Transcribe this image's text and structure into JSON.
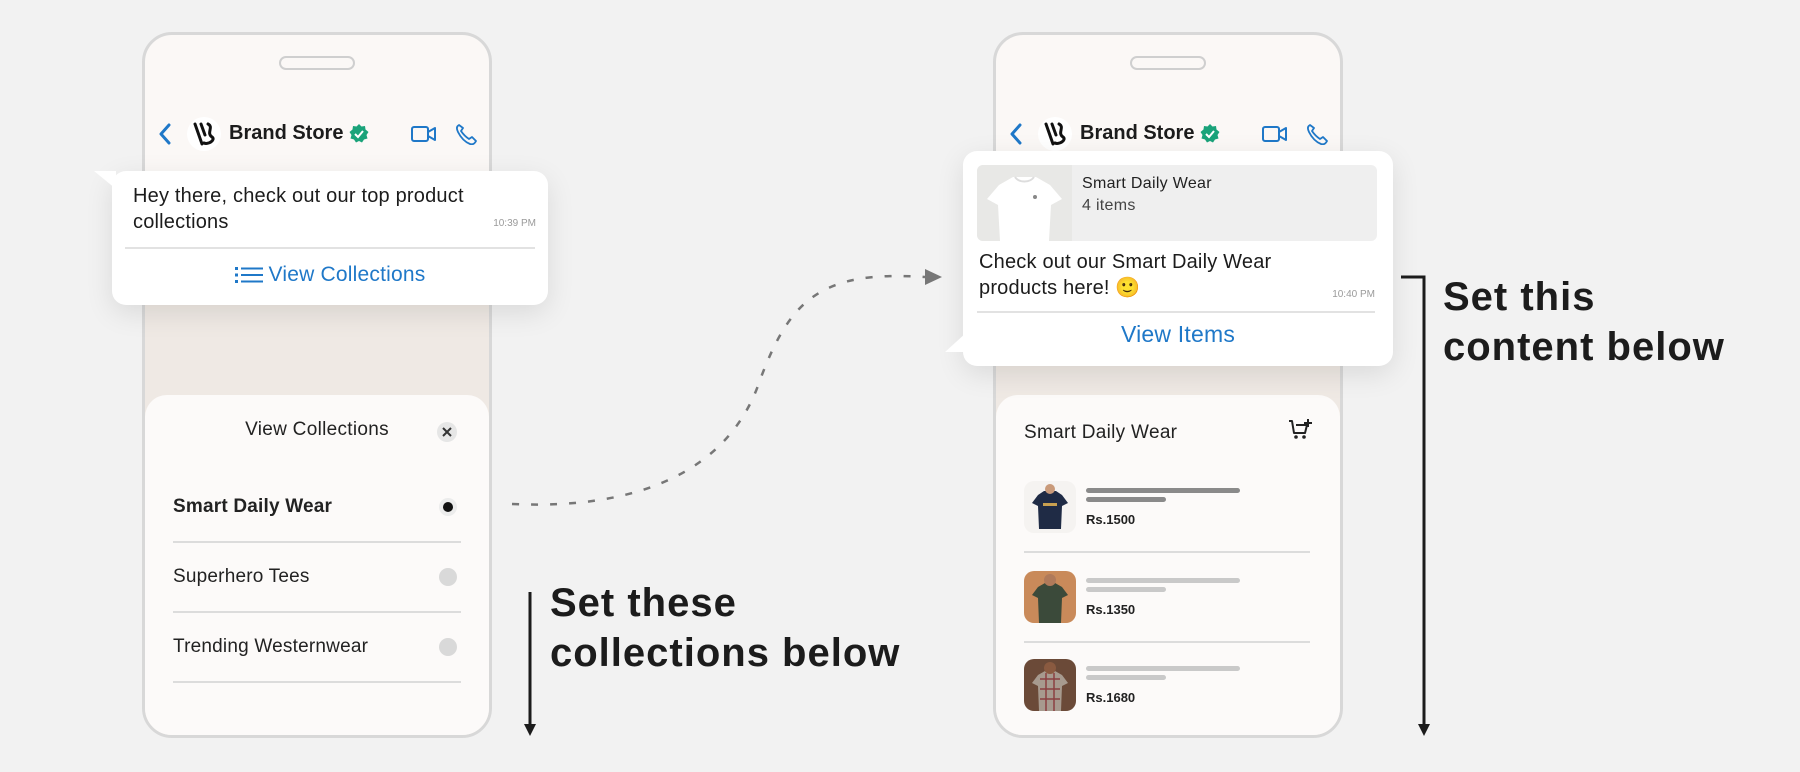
{
  "left_phone": {
    "header": {
      "brand_name": "Brand Store"
    },
    "message": {
      "text": "Hey there, check out our top product collections",
      "time": "10:39 PM",
      "action_label": "View Collections"
    },
    "sheet": {
      "title": "View Collections",
      "items": [
        {
          "label": "Smart Daily Wear",
          "selected": true
        },
        {
          "label": "Superhero Tees",
          "selected": false
        },
        {
          "label": "Trending Westernwear",
          "selected": false
        }
      ]
    }
  },
  "right_phone": {
    "header": {
      "brand_name": "Brand Store"
    },
    "message": {
      "card_title": "Smart Daily Wear",
      "card_count": "4 items",
      "text": "Check out our Smart Daily Wear products here! 🙂",
      "time": "10:40 PM",
      "action_label": "View Items"
    },
    "sheet": {
      "title": "Smart Daily Wear",
      "products": [
        {
          "price": "Rs.1500",
          "shirt_color": "#1f2b45"
        },
        {
          "price": "Rs.1350",
          "shirt_color": "#3b4a3a"
        },
        {
          "price": "Rs.1680",
          "shirt_color": "#a79a8e"
        }
      ]
    }
  },
  "annotations": {
    "left_line1": "Set these",
    "left_line2": "collections below",
    "right_line1": "Set this",
    "right_line2": "content below"
  },
  "colors": {
    "accent_blue": "#1f78c8",
    "verified_green": "#1aa37a",
    "background": "#f2f2f2"
  },
  "icons": [
    "back-icon",
    "brand-logo-icon",
    "verified-icon",
    "video-call-icon",
    "phone-call-icon",
    "list-icon",
    "close-icon",
    "add-to-cart-icon"
  ]
}
